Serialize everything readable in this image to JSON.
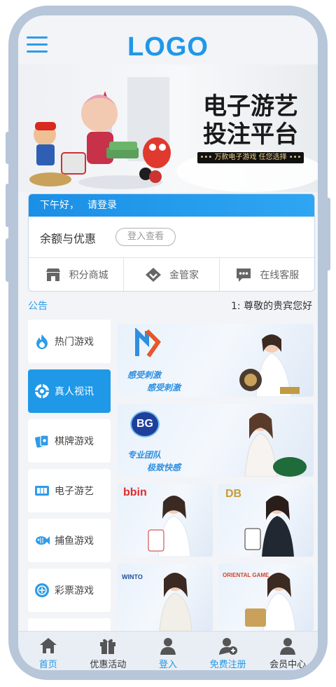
{
  "header": {
    "logo": "LOGO"
  },
  "banner": {
    "title_line1": "电子游艺",
    "title_line2": "投注平台",
    "subtitle": "••• 万款电子游戏 任您选择 •••"
  },
  "user": {
    "greeting": "下午好，",
    "login_link": "请登录",
    "balance_label": "余额与优惠",
    "view_button": "登入查看",
    "quick_links": [
      "积分商城",
      "金管家",
      "在线客服"
    ]
  },
  "notice": {
    "label": "公告",
    "message": "1: 尊敬的贵宾您好"
  },
  "categories": [
    {
      "label": "热门游戏",
      "icon": "flame-icon"
    },
    {
      "label": "真人视讯",
      "icon": "chip-icon",
      "active": true
    },
    {
      "label": "棋牌游戏",
      "icon": "cards-icon"
    },
    {
      "label": "电子游艺",
      "icon": "slot-icon"
    },
    {
      "label": "捕鱼游戏",
      "icon": "fish-icon"
    },
    {
      "label": "彩票游戏",
      "icon": "lottery-icon"
    }
  ],
  "games": {
    "card1": {
      "slogan_top": "感受刺激",
      "slogan_bottom": "感受刺激"
    },
    "card2": {
      "brand": "BG",
      "slogan_top": "专业团队",
      "slogan_bottom": "极致快感"
    },
    "card3": {
      "brand": "bbin"
    },
    "card4": {
      "brand": "DB"
    },
    "card5": {
      "brand": "WINTO"
    },
    "card6": {
      "brand": "ORIENTAL GAME"
    }
  },
  "tabbar": [
    "首页",
    "优惠活动",
    "登入",
    "免费注册",
    "会员中心"
  ],
  "colors": {
    "primary": "#1f98e8",
    "frame": "#b7c6d9"
  }
}
